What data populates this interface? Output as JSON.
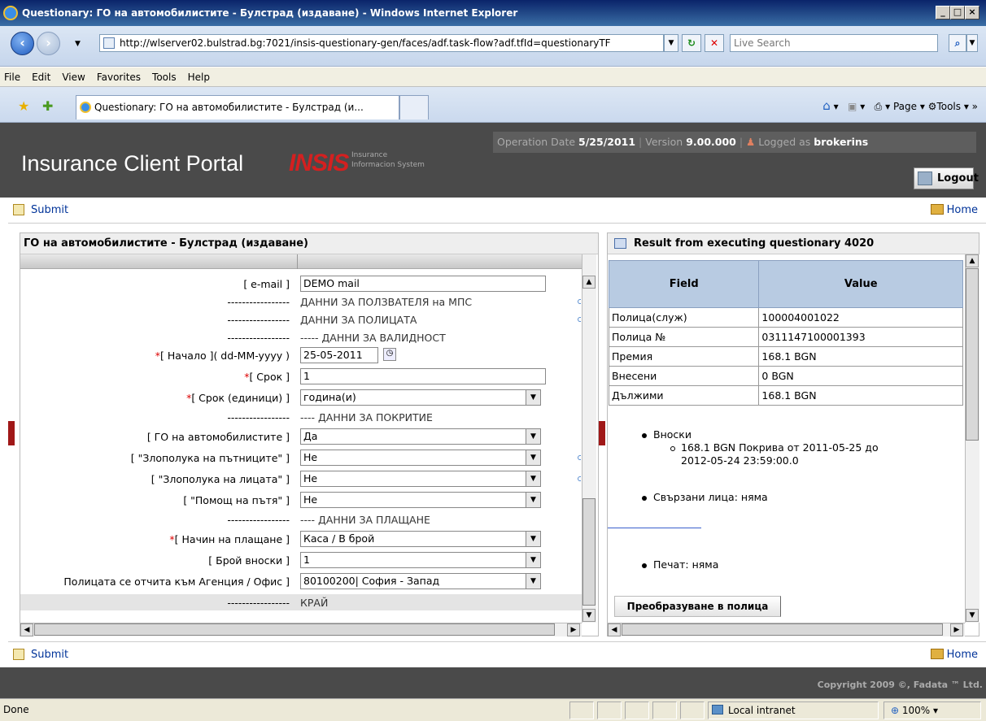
{
  "window": {
    "title": "Questionary: ГО на автомобилистите - Булстрад (издаване) - Windows Internet Explorer"
  },
  "browser": {
    "address": "http://wlserver02.bulstrad.bg:7021/insis-questionary-gen/faces/adf.task-flow?adf.tfId=questionaryTF",
    "search_placeholder": "Live Search",
    "menu": [
      "File",
      "Edit",
      "View",
      "Favorites",
      "Tools",
      "Help"
    ],
    "tab_title": "Questionary: ГО на автомобилистите - Булстрад (и...",
    "toolbar": {
      "page": "Page",
      "tools": "Tools"
    }
  },
  "portal": {
    "brand": "Insurance Client Portal",
    "logo": "INSIS",
    "logo_sub1": "Insurance",
    "logo_sub2": "Informacion System",
    "op_date_label": "Operation Date",
    "op_date": "5/25/2011",
    "version_label": "Version",
    "version": "9.00.000",
    "logged_label": "Logged as",
    "user": "brokerins",
    "logout": "Logout"
  },
  "actions": {
    "submit": "Submit",
    "home": "Home"
  },
  "form": {
    "title": "ГО на автомобилистите - Булстрад (издаване)",
    "rows": [
      {
        "label": "[ e-mail ]",
        "type": "input",
        "value": "DEMO mail"
      },
      {
        "label": "-----------------",
        "type": "section",
        "value": "ДАННИ ЗА ПОЛЗВАТЕЛЯ на МПС"
      },
      {
        "label": "-----------------",
        "type": "section",
        "value": "ДАННИ ЗА ПОЛИЦАТА"
      },
      {
        "label": "-----------------",
        "type": "section",
        "value": "----- ДАННИ ЗА ВАЛИДНОСТ"
      },
      {
        "label": "[ Начало ]( dd-MM-yyyy )",
        "type": "date",
        "value": "25-05-2011",
        "required": true
      },
      {
        "label": "[ Срок ]",
        "type": "input",
        "value": "1",
        "required": true
      },
      {
        "label": "[ Срок (единици) ]",
        "type": "select",
        "value": "година(и)",
        "required": true
      },
      {
        "label": "-----------------",
        "type": "section",
        "value": "---- ДАННИ ЗА ПОКРИТИЕ"
      },
      {
        "label": "[ ГО на автомобилистите ]",
        "type": "select",
        "value": "Да"
      },
      {
        "label": "[ \"Злополука на пътниците\" ]",
        "type": "select",
        "value": "Не"
      },
      {
        "label": "[ \"Злополука на лицата\" ]",
        "type": "select",
        "value": "Не"
      },
      {
        "label": "[ \"Помощ на пътя\" ]",
        "type": "select",
        "value": "Не"
      },
      {
        "label": "-----------------",
        "type": "section",
        "value": "---- ДАННИ ЗА ПЛАЩАНЕ"
      },
      {
        "label": "[ Начин на плащане ]",
        "type": "select",
        "value": "Каса / В брой",
        "required": true
      },
      {
        "label": "[ Брой вноски ]",
        "type": "select",
        "value": "1"
      },
      {
        "label": "Полицата се отчита към Агенция / Офис ]",
        "type": "select",
        "value": "80100200| София - Запад"
      },
      {
        "label": "-----------------",
        "type": "section",
        "value": "КРАЙ"
      }
    ]
  },
  "result": {
    "title": "Result from executing questionary 4020",
    "headers": [
      "Field",
      "Value"
    ],
    "rows": [
      [
        "Полица(служ)",
        "100004001022"
      ],
      [
        "Полица №",
        "0311147100001393"
      ],
      [
        "Премия",
        "168.1 BGN"
      ],
      [
        "Внесени",
        "0 BGN"
      ],
      [
        "Дължими",
        "168.1 BGN"
      ]
    ],
    "installments_label": "Вноски",
    "installment_line1": "168.1 BGN Покрива от 2011-05-25 до",
    "installment_line2": "2012-05-24 23:59:00.0",
    "related": "Свързани лица: няма",
    "print": "Печат: няма",
    "convert_button": "Преобразуване в полица"
  },
  "footer": {
    "copyright": "Copyright 2009 ©, Fadata ™ Ltd."
  },
  "status": {
    "text": "Done",
    "zone": "Local intranet",
    "zoom": "100%"
  }
}
